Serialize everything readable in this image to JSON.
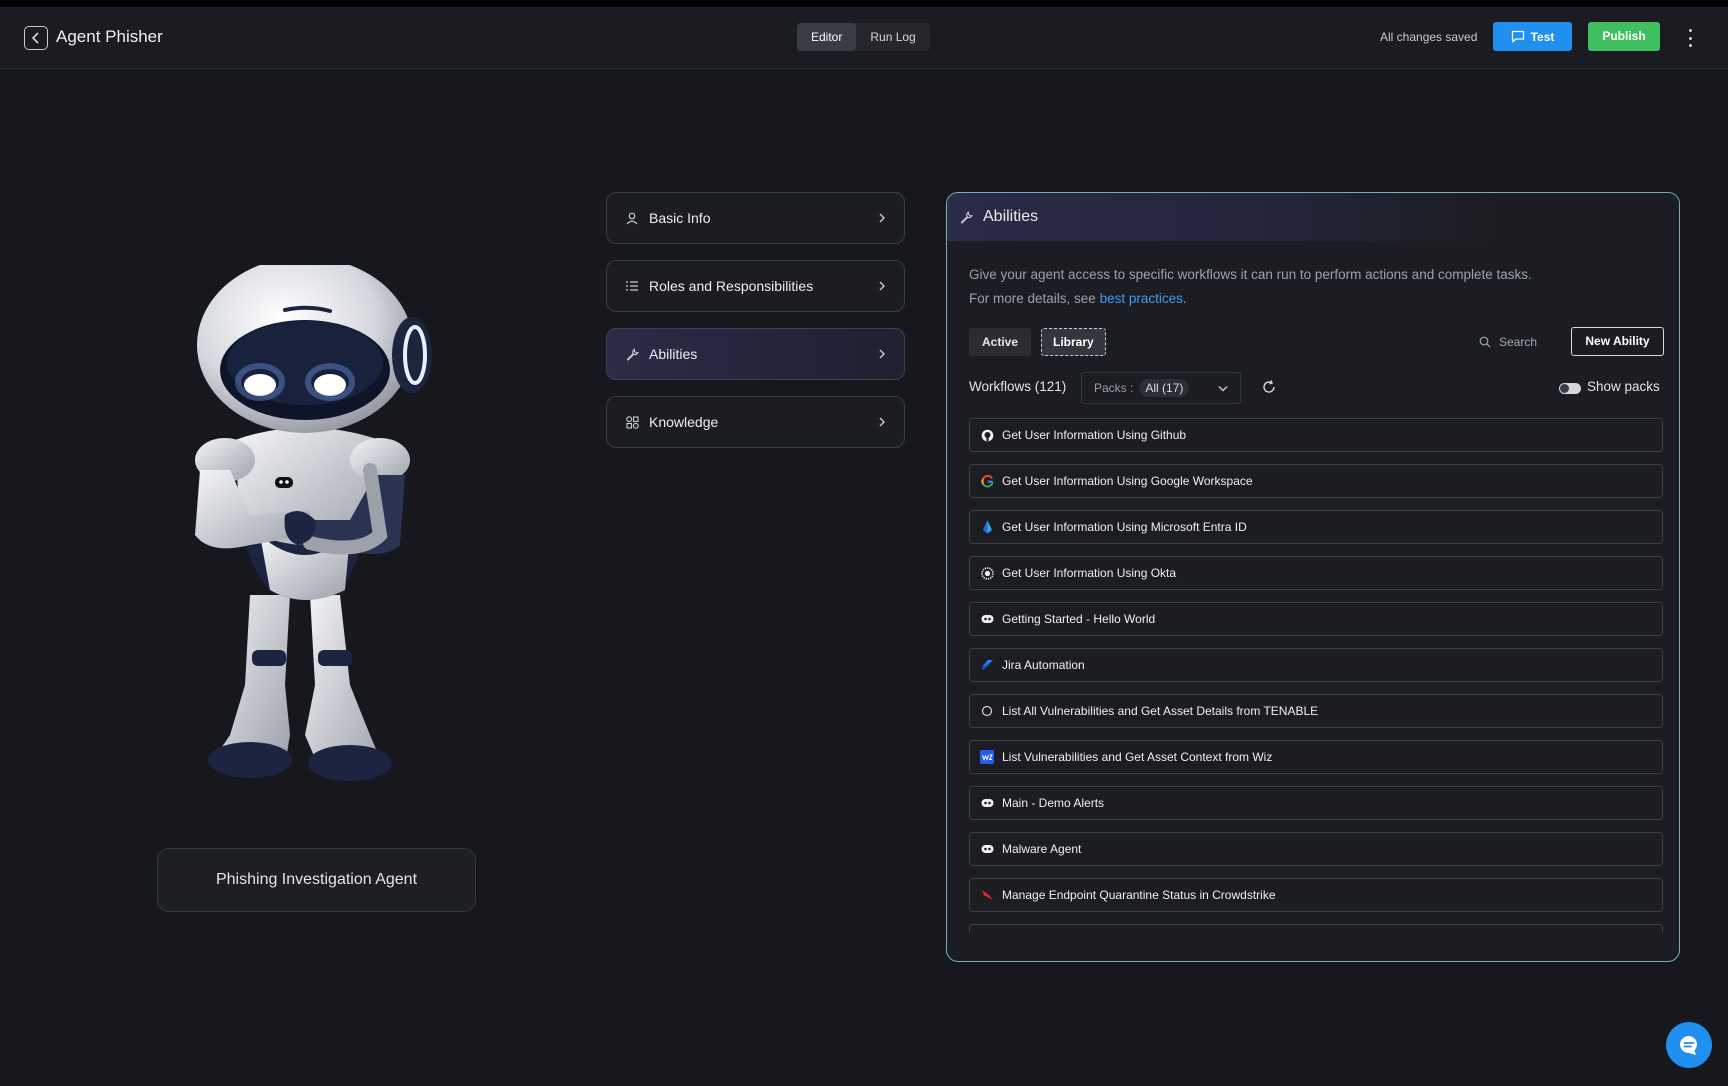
{
  "header": {
    "title": "Agent Phisher",
    "tabs": [
      {
        "label": "Editor"
      },
      {
        "label": "Run Log"
      }
    ],
    "save_status": "All changes saved",
    "test_label": "Test",
    "publish_label": "Publish"
  },
  "agent": {
    "name": "Phishing Investigation Agent"
  },
  "nav": [
    {
      "label": "Basic Info",
      "icon": "user-icon"
    },
    {
      "label": "Roles and Responsibilities",
      "icon": "list-icon"
    },
    {
      "label": "Abilities",
      "icon": "wrench-icon"
    },
    {
      "label": "Knowledge",
      "icon": "shapes-icon"
    }
  ],
  "abilities": {
    "title": "Abilities",
    "description_line1": "Give your agent access to specific workflows it can run to perform actions and complete tasks.",
    "description_prefix": "For more details, see ",
    "description_link": "best practices",
    "description_suffix": ".",
    "seg_active": "Active",
    "seg_library": "Library",
    "search_label": "Search",
    "new_ability_label": "New Ability",
    "workflows_count": "Workflows (121)",
    "packs_label": "Packs :",
    "packs_value": "All (17)",
    "show_packs_label": "Show packs",
    "workflows": [
      {
        "name": "Get User Information Using Github",
        "icon": "github-icon"
      },
      {
        "name": "Get User Information Using Google Workspace",
        "icon": "google-icon"
      },
      {
        "name": "Get User Information Using Microsoft Entra ID",
        "icon": "entra-icon"
      },
      {
        "name": "Get User Information Using Okta",
        "icon": "okta-icon"
      },
      {
        "name": "Getting Started - Hello World",
        "icon": "bot-icon"
      },
      {
        "name": "Jira Automation",
        "icon": "jira-icon"
      },
      {
        "name": "List All Vulnerabilities and Get Asset Details from TENABLE",
        "icon": "tenable-icon"
      },
      {
        "name": "List Vulnerabilities and Get Asset Context from Wiz",
        "icon": "wiz-icon"
      },
      {
        "name": "Main - Demo Alerts",
        "icon": "bot-icon"
      },
      {
        "name": "Malware Agent",
        "icon": "bot-icon"
      },
      {
        "name": "Manage Endpoint Quarantine Status in Crowdstrike",
        "icon": "crowdstrike-icon"
      }
    ]
  },
  "colors": {
    "accent": "#1f8ff0",
    "publish": "#3fbf5d",
    "link": "#3d9cf5",
    "panel_border": "#6fb3b8"
  }
}
